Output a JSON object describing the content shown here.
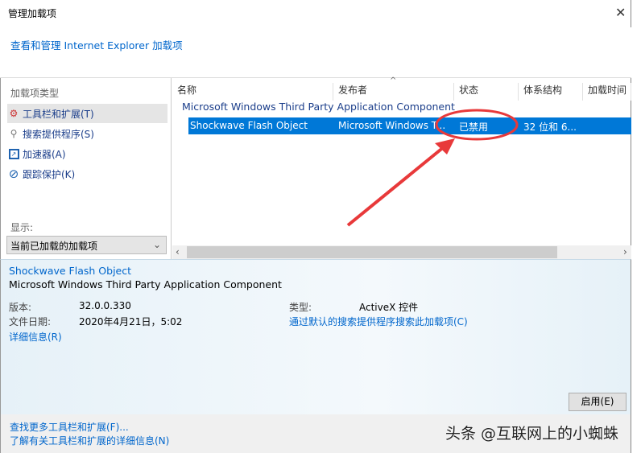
{
  "window": {
    "title": "管理加载项",
    "close_icon": "close-icon"
  },
  "header_link": "查看和管理 Internet Explorer 加载项",
  "left": {
    "heading": "加载项类型",
    "items": [
      {
        "label": "工具栏和扩展(T)",
        "icon": "gear-icon"
      },
      {
        "label": "搜索提供程序(S)",
        "icon": "search-icon"
      },
      {
        "label": "加速器(A)",
        "icon": "accelerator-icon"
      },
      {
        "label": "跟踪保护(K)",
        "icon": "block-icon"
      }
    ],
    "show_label": "显示:",
    "show_value": "当前已加载的加载项"
  },
  "list": {
    "columns": [
      "名称",
      "发布者",
      "状态",
      "体系结构",
      "加载时间"
    ],
    "group": "Microsoft Windows Third Party Application Component",
    "row": {
      "name": "Shockwave Flash Object",
      "publisher": "Microsoft Windows T...",
      "status": "已禁用",
      "arch": "32 位和 6..."
    }
  },
  "details": {
    "name": "Shockwave Flash Object",
    "publisher": "Microsoft Windows Third Party Application Component",
    "version_label": "版本:",
    "version": "32.0.0.330",
    "date_label": "文件日期:",
    "date": "2020年4月21日，5:02",
    "more_info": "详细信息(R)",
    "type_label": "类型:",
    "type": "ActiveX 控件",
    "search_link": "通过默认的搜索提供程序搜索此加载项(C)",
    "enable_button": "启用(E)"
  },
  "footer": {
    "link1": "查找更多工具栏和扩展(F)...",
    "link2": "了解有关工具栏和扩展的详细信息(N)"
  },
  "watermark": "头条 @互联网上的小蜘蛛",
  "annotation_color": "#e8393a"
}
